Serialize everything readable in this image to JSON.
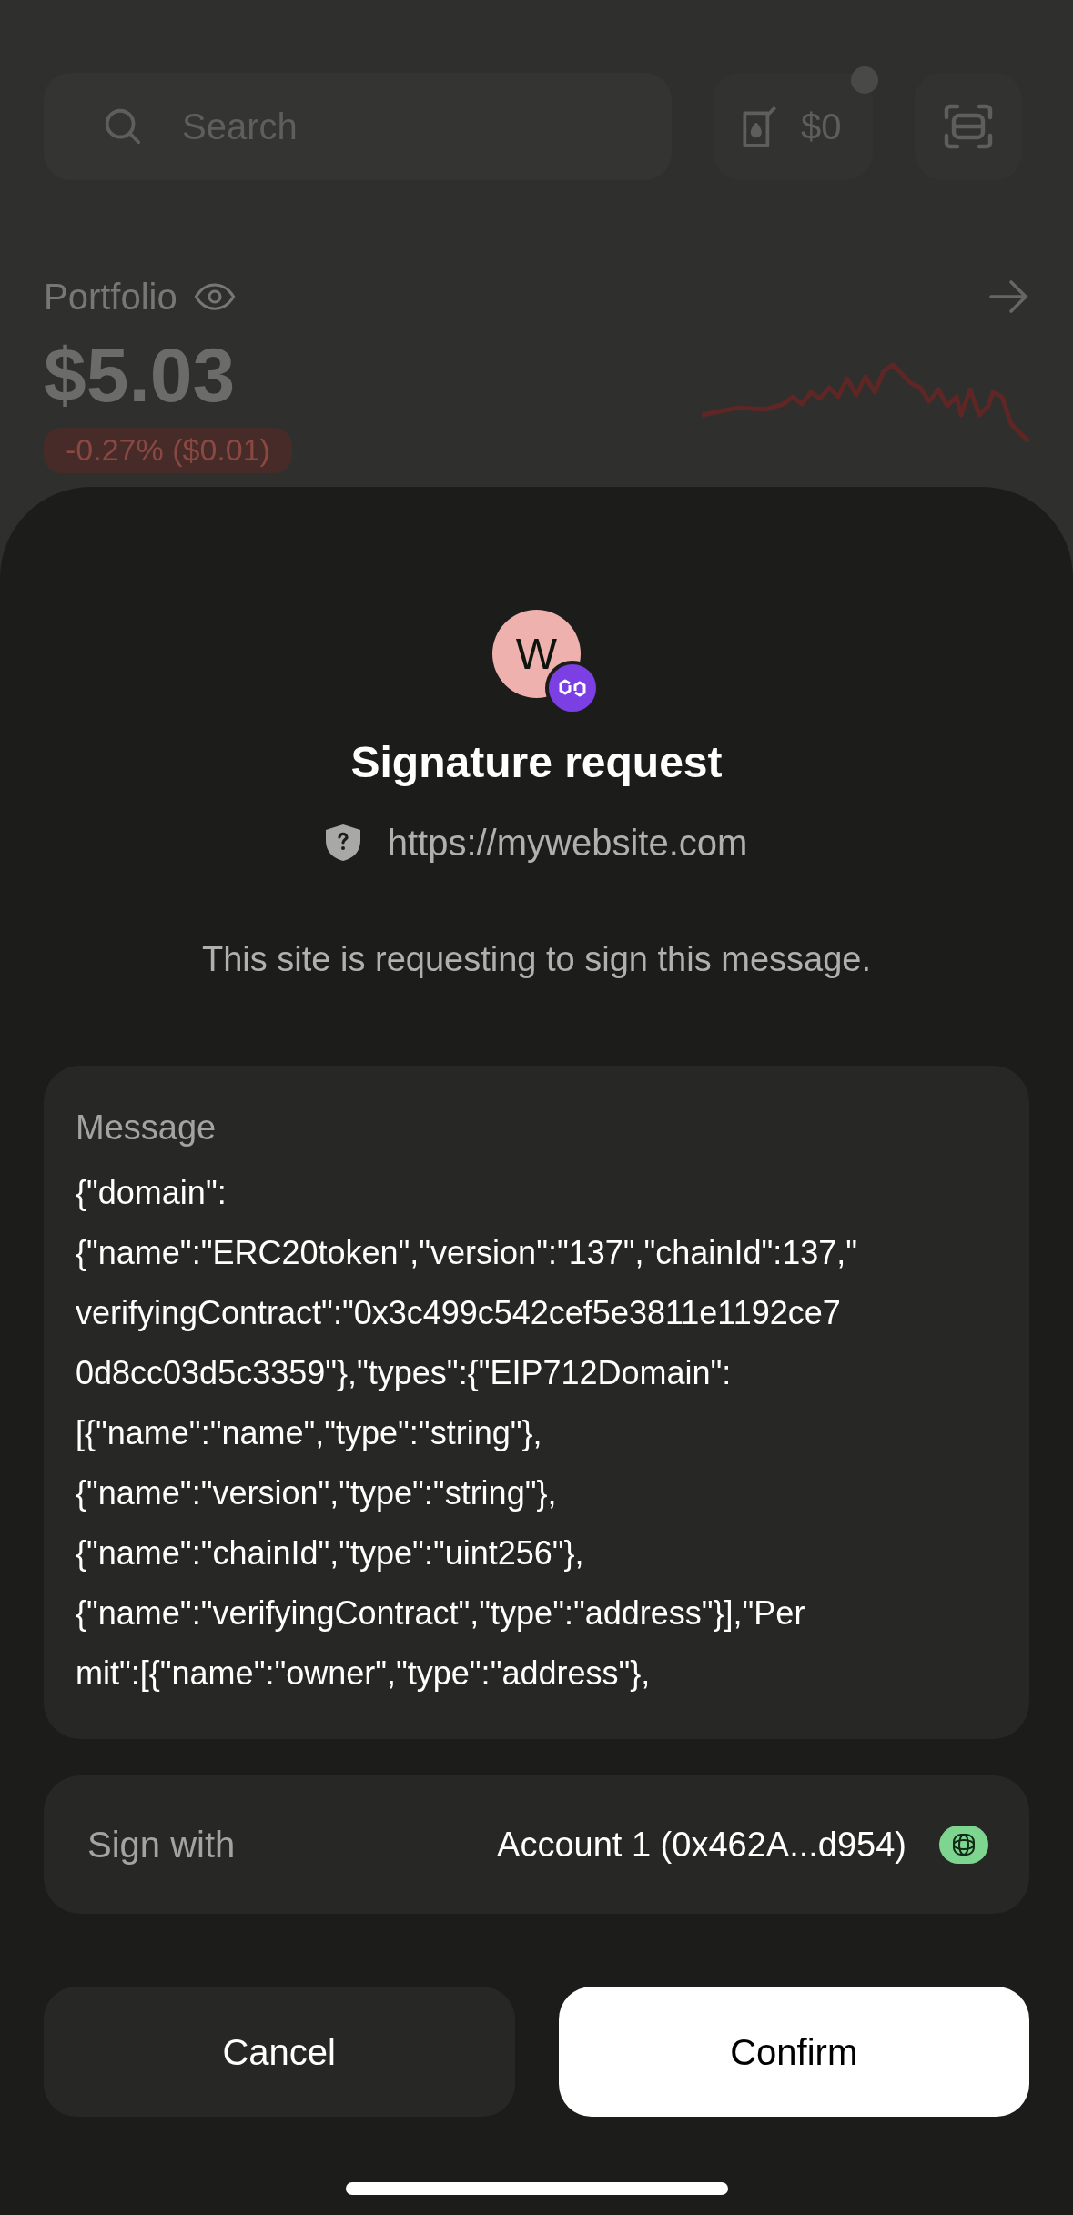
{
  "home": {
    "search": {
      "placeholder": "Search"
    },
    "gas_button": {
      "label": "$0",
      "notification": true
    },
    "portfolio": {
      "label": "Portfolio",
      "balance": "$5.03",
      "change": "-0.27% ($0.01)"
    }
  },
  "sheet": {
    "avatar": {
      "letter": "W",
      "color": "#eeb1ae"
    },
    "title": "Signature request",
    "url": "https://mywebsite.com",
    "description": "This site is requesting to sign this message.",
    "message": {
      "label": "Message",
      "lines": [
        "{\"domain\":",
        "{\"name\":\"ERC20token\",\"version\":\"137\",\"chainId\":137,\"",
        "verifyingContract\":\"0x3c499c542cef5e3811e1192ce7",
        "0d8cc03d5c3359\"},\"types\":{\"EIP712Domain\":",
        "[{\"name\":\"name\",\"type\":\"string\"},",
        "{\"name\":\"version\",\"type\":\"string\"},",
        "{\"name\":\"chainId\",\"type\":\"uint256\"},",
        "{\"name\":\"verifyingContract\",\"type\":\"address\"}],\"Per",
        "mit\":[{\"name\":\"owner\",\"type\":\"address\"},"
      ]
    },
    "sign_with": {
      "label": "Sign with",
      "account": "Account 1 (0x462A...d954)"
    },
    "buttons": [
      {
        "label": "Cancel",
        "kind": "secondary"
      },
      {
        "label": "Confirm",
        "kind": "primary"
      }
    ]
  }
}
